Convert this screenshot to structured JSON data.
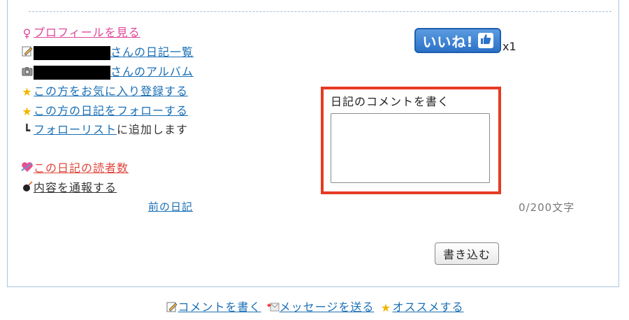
{
  "links": {
    "profile": "プロフィールを見る",
    "diary_list_suffix": "さんの日記一覧",
    "album_suffix": "さんのアルバム",
    "favorite": "この方をお気に入り登録する",
    "follow": "この方の日記をフォローする",
    "follow_list_prefix": "┗",
    "follow_list_link": "フォローリスト",
    "follow_list_suffix": "に追加します",
    "readers": "この日記の読者数",
    "report": "内容を通報する",
    "prev": "前の日記"
  },
  "like": {
    "label": "いいね!",
    "count": "x1"
  },
  "comment": {
    "label": "日記のコメントを書く",
    "value": "",
    "char_count": "0/200文字",
    "submit": "書き込む"
  },
  "footer": {
    "write_comment": "コメントを書く",
    "send_message": "メッセージを送る",
    "recommend": "オススメする"
  },
  "colors": {
    "link_blue": "#1a6fb5",
    "link_pink": "#e0469a",
    "link_red": "#e0453b",
    "highlight_border": "#e63b22",
    "like_button": "#2b72c8"
  },
  "icons": [
    "female-icon",
    "pencil-icon",
    "camera-icon",
    "star-icon",
    "star-icon",
    "heart-icon",
    "bomb-icon",
    "pencil-icon",
    "envelope-icon",
    "star-icon"
  ]
}
